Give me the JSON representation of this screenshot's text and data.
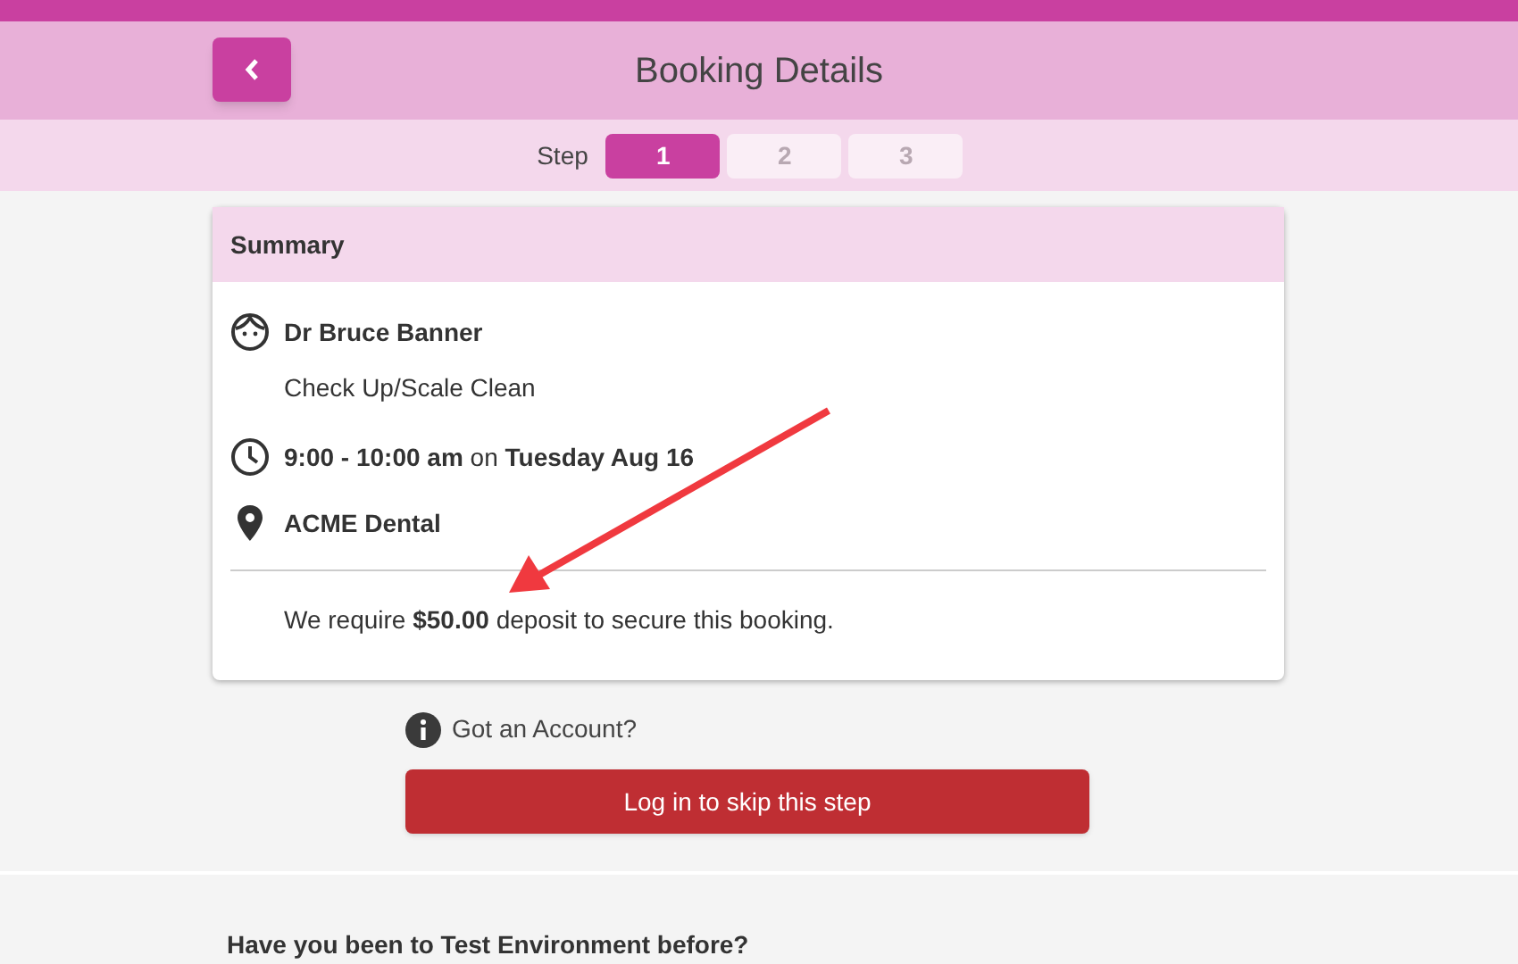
{
  "header": {
    "title": "Booking Details"
  },
  "steps": {
    "label": "Step",
    "items": [
      {
        "label": "1",
        "selected": true
      },
      {
        "label": "2",
        "selected": false
      },
      {
        "label": "3",
        "selected": false
      }
    ]
  },
  "summary": {
    "title": "Summary",
    "items": [
      {
        "kind": "practitioner",
        "text": "**Dr Bruce Banner**",
        "subtext": "Check Up/Scale Clean"
      },
      {
        "kind": "time",
        "text": "**9:00 - 10:00 am** on **Tuesday Aug 16**"
      },
      {
        "kind": "location",
        "text": "**ACME Dental**"
      }
    ],
    "deposit": "We require **$50.00** deposit to secure this booking."
  },
  "account": {
    "prompt": "Got an Account?",
    "button": "Log in to skip this step"
  },
  "question": "Have you been to Test Environment before?"
}
